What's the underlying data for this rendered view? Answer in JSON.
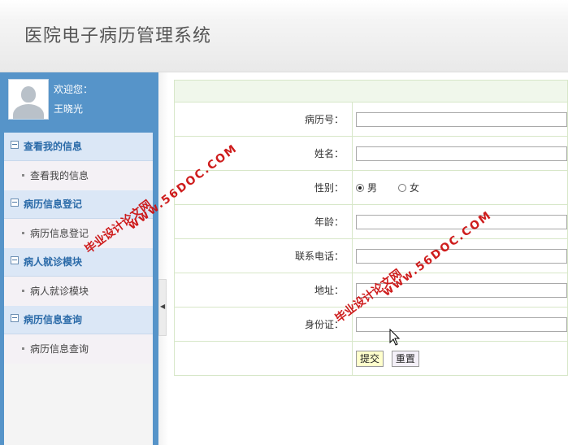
{
  "header": {
    "title": "医院电子病历管理系统"
  },
  "user": {
    "welcome": "欢迎您：",
    "name": "王晓光"
  },
  "menu": [
    {
      "title": "查看我的信息",
      "item": "查看我的信息"
    },
    {
      "title": "病历信息登记",
      "item": "病历信息登记"
    },
    {
      "title": "病人就诊模块",
      "item": "病人就诊模块"
    },
    {
      "title": "病历信息查询",
      "item": "病历信息查询"
    }
  ],
  "form": {
    "record_no_label": "病历号：",
    "name_label": "姓名：",
    "gender_label": "性别：",
    "gender_male": "男",
    "gender_female": "女",
    "age_label": "年龄：",
    "phone_label": "联系电话：",
    "address_label": "地址：",
    "id_label": "身份证：",
    "submit": "提交",
    "reset": "重置"
  },
  "watermark": {
    "site_text": "毕业设计论文网",
    "url": "www.56DOC.COM"
  },
  "colors": {
    "sidebar": "#5694c9",
    "menu_head_bg": "#dbe7f6",
    "menu_head_text": "#2a6aa8",
    "table_border": "#d7e7c8",
    "watermark": "#cc1111"
  }
}
